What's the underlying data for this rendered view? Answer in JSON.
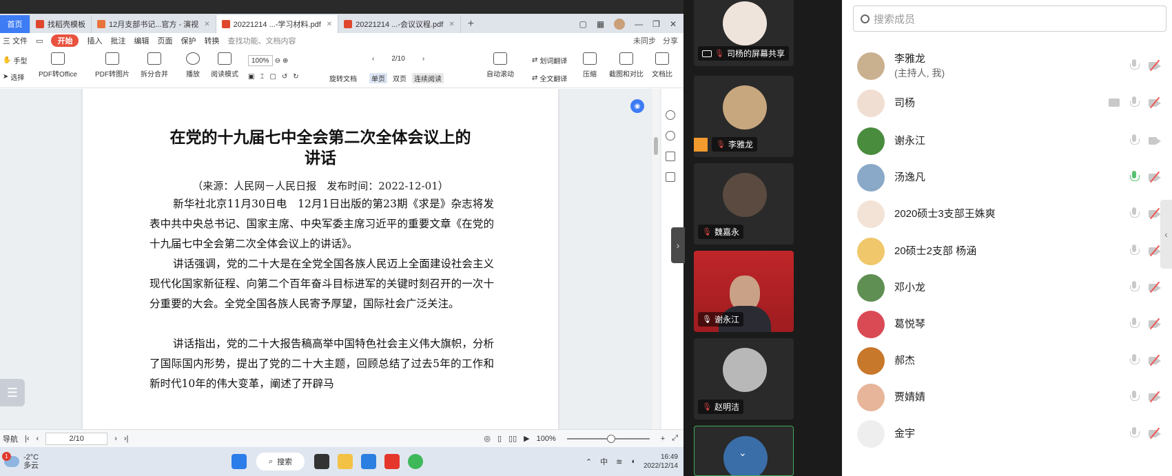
{
  "wps": {
    "tabs": [
      {
        "label": "首页"
      },
      {
        "label": "找稻壳模板"
      },
      {
        "label": "12月支部书记...官方 - 演视"
      },
      {
        "label": "20221214 ...-学习材料.pdf"
      },
      {
        "label": "20221214 ...-会议议程.pdf"
      }
    ],
    "menu": {
      "file": "三 文件",
      "start": "开始",
      "items": [
        "插入",
        "批注",
        "编辑",
        "页面",
        "保护",
        "转换"
      ],
      "search": "查找功能、文档内容",
      "sync": "未同步",
      "share": "分享"
    },
    "ribbon": {
      "hand": "手型",
      "select": "选择",
      "pdf_to_office": "PDF转Office",
      "pdf_to_image": "PDF转图片",
      "split_merge": "拆分合并",
      "play": "播放",
      "read_mode": "阅读模式",
      "zoom": "100%",
      "page_indicator": "2/10",
      "rotate": "旋转文档",
      "single": "单页",
      "double": "双页",
      "continuous": "连续阅读",
      "auto_scroll": "自动滚动",
      "translate_select": "划词翻译",
      "translate_all": "全文翻译",
      "compress": "压缩",
      "ocr_compare": "截图和对比",
      "doc_more": "文档比"
    },
    "document": {
      "title_line1": "在党的十九届七中全会第二次全体会议上的",
      "title_line2": "讲话",
      "source": "（来源：人民网－人民日报　发布时间：2022-12-01）",
      "para1": "新华社北京11月30日电　12月1日出版的第23期《求是》杂志将发表中共中央总书记、国家主席、中央军委主席习近平的重要文章《在党的十九届七中全会第二次全体会议上的讲话》。",
      "para2": "讲话强调，党的二十大是在全党全国各族人民迈上全面建设社会主义现代化国家新征程、向第二个百年奋斗目标进军的关键时刻召开的一次十分重要的大会。全党全国各族人民寄予厚望，国际社会广泛关注。",
      "para3": "讲话指出，党的二十大报告稿高举中国特色社会主义伟大旗帜，分析了国际国内形势，提出了党的二十大主题，回顾总结了过去5年的工作和新时代10年的伟大变革，阐述了开辟马"
    },
    "status": {
      "nav": "导航",
      "page": "2/10",
      "zoom": "100%"
    },
    "taskbar": {
      "temp": "-2°C",
      "weather": "多云",
      "badge": "1",
      "search": "搜索",
      "ime": "中",
      "time": "16:49",
      "date": "2022/12/14"
    }
  },
  "video_tiles": [
    {
      "label": "司杨的屏幕共享"
    },
    {
      "label": "李雅龙"
    },
    {
      "label": "魏嘉永"
    },
    {
      "label": "谢永江"
    },
    {
      "label": "赵明洁"
    }
  ],
  "members_panel": {
    "search_placeholder": "搜索成员",
    "members": [
      {
        "name": "李雅龙",
        "sub": "(主持人, 我)",
        "mic": "muted",
        "cam": "off",
        "avatar_color": "#c9b08f"
      },
      {
        "name": "司杨",
        "sub": "",
        "mic": "muted",
        "cam": "off",
        "screen": true,
        "avatar_color": "#f1ded2"
      },
      {
        "name": "谢永江",
        "sub": "",
        "mic": "on",
        "cam": "on",
        "avatar_color": "#4a8c3e"
      },
      {
        "name": "汤逸凡",
        "sub": "",
        "mic": "active",
        "cam": "off",
        "avatar_color": "#8aa8c7"
      },
      {
        "name": "2020硕士3支部王姝爽",
        "sub": "",
        "mic": "muted",
        "cam": "off",
        "avatar_color": "#f3e3d6"
      },
      {
        "name": "20硕士2支部 杨涵",
        "sub": "",
        "mic": "muted",
        "cam": "off",
        "avatar_color": "#f0c76a"
      },
      {
        "name": "邓小龙",
        "sub": "",
        "mic": "muted",
        "cam": "off",
        "avatar_color": "#5f8f52"
      },
      {
        "name": "葛悦琴",
        "sub": "",
        "mic": "muted",
        "cam": "off",
        "avatar_color": "#d94a55"
      },
      {
        "name": "郝杰",
        "sub": "",
        "mic": "muted",
        "cam": "off",
        "avatar_color": "#c7782a"
      },
      {
        "name": "贾婧婧",
        "sub": "",
        "mic": "muted",
        "cam": "off",
        "avatar_color": "#e7b59a"
      },
      {
        "name": "金宇",
        "sub": "",
        "mic": "muted",
        "cam": "off",
        "avatar_color": "#eeeeee"
      }
    ]
  }
}
